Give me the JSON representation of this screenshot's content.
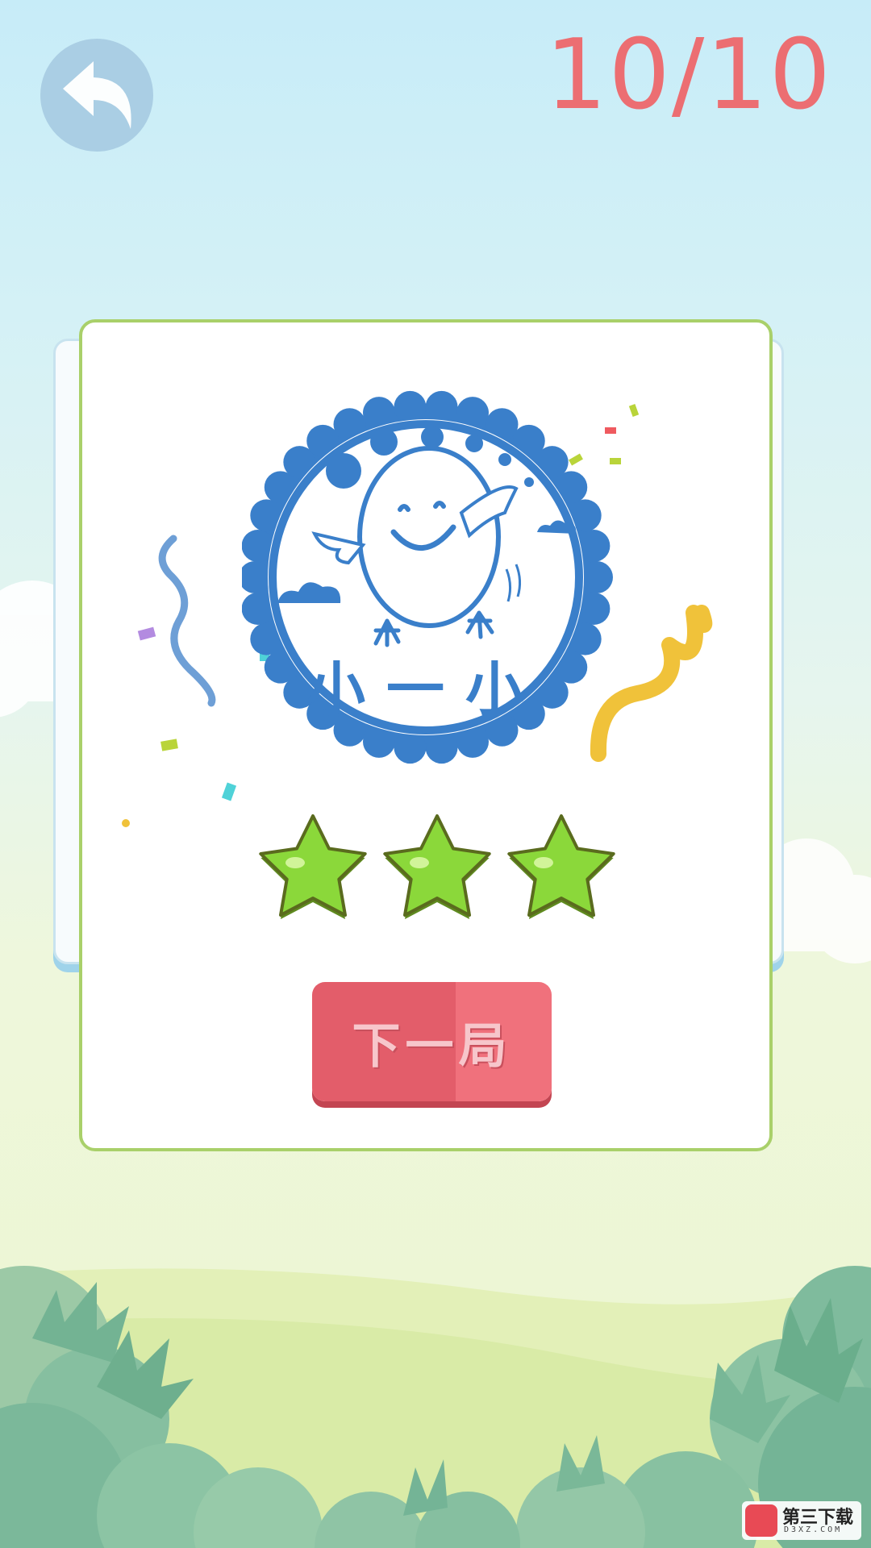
{
  "header": {
    "back_icon": "undo-arrow-icon",
    "progress": "10/10"
  },
  "result_card": {
    "badge_icon": "smiling-egg-mascot-badge-icon",
    "badge_text": "小一小",
    "stars_earned": 3,
    "stars_total": 3,
    "next_button_label": "下一局"
  },
  "watermark": {
    "name": "第三下载",
    "domain": "D3XZ.COM"
  },
  "colors": {
    "accent_red": "#ec6e72",
    "button_red": "#e35d6a",
    "badge_blue": "#3a7fca",
    "card_border": "#a9d06a",
    "star_green": "#8bd83a"
  }
}
